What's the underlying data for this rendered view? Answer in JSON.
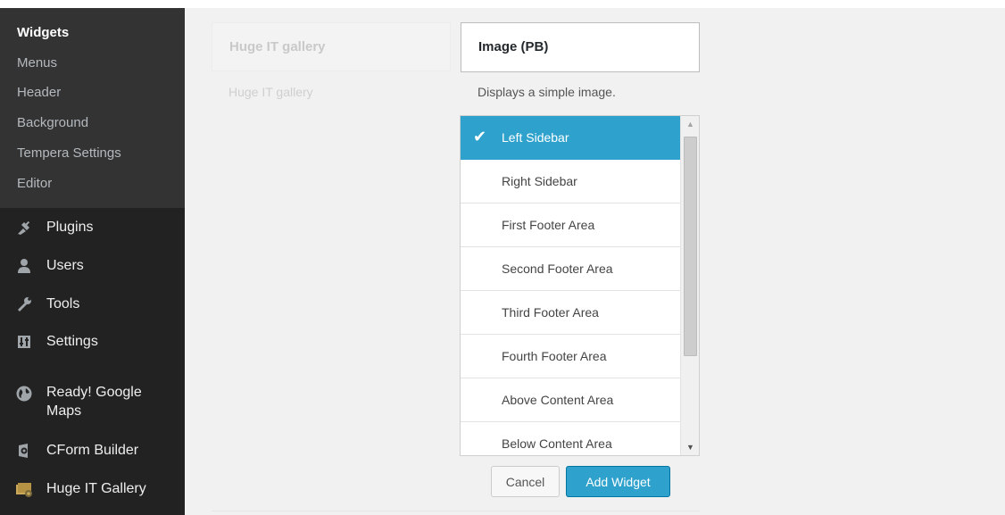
{
  "sidebar": {
    "submenu": [
      {
        "label": "Widgets",
        "current": true
      },
      {
        "label": "Menus"
      },
      {
        "label": "Header"
      },
      {
        "label": "Background"
      },
      {
        "label": "Tempera Settings"
      },
      {
        "label": "Editor"
      }
    ],
    "menu": [
      {
        "label": "Plugins",
        "icon": "plugins-icon"
      },
      {
        "label": "Users",
        "icon": "users-icon"
      },
      {
        "label": "Tools",
        "icon": "tools-icon"
      },
      {
        "label": "Settings",
        "icon": "settings-icon"
      },
      {
        "label_line1": "Ready! Google",
        "label_line2": "Maps",
        "icon": "globe-icon"
      },
      {
        "label": "CForm Builder",
        "icon": "cform-icon"
      },
      {
        "label": "Huge IT Gallery",
        "icon": "gallery-icon"
      }
    ]
  },
  "widgets": {
    "available": {
      "title": "Huge IT gallery",
      "description": "Huge IT gallery"
    },
    "chooser": {
      "title": "Image (PB)",
      "description": "Displays a simple image.",
      "areas": [
        {
          "label": "Left Sidebar",
          "selected": true
        },
        {
          "label": "Right Sidebar"
        },
        {
          "label": "First Footer Area"
        },
        {
          "label": "Second Footer Area"
        },
        {
          "label": "Third Footer Area"
        },
        {
          "label": "Fourth Footer Area"
        },
        {
          "label": "Above Content Area"
        },
        {
          "label": "Below Content Area"
        }
      ],
      "cancel_label": "Cancel",
      "add_label": "Add Widget"
    }
  },
  "colors": {
    "sidebar_bg": "#222222",
    "submenu_bg": "#333333",
    "accent": "#2ea2cc"
  }
}
